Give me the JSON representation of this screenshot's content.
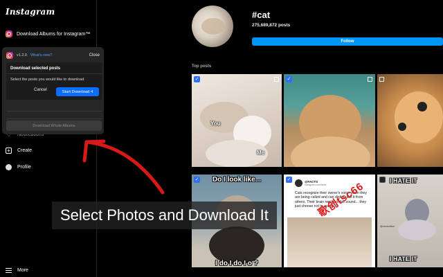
{
  "sidebar": {
    "logo": "Instagram",
    "extension_label": "Download Albums for Instagram™",
    "items": [
      {
        "label": "Notifications"
      },
      {
        "label": "Create"
      },
      {
        "label": "Profile"
      },
      {
        "label": "More"
      }
    ]
  },
  "popup": {
    "version": "v1.2.0",
    "whats_new": "What's new?",
    "close": "Close",
    "card_title": "Download selected posts",
    "card_text": "Select the posts you would like to download",
    "cancel": "Cancel",
    "start": "Start Download 4",
    "whole_albums": "Download Whole Albums"
  },
  "profile": {
    "hashtag": "#cat",
    "posts": "275,689,872 posts",
    "follow": "Follow",
    "top_posts": "Top posts"
  },
  "grid": {
    "t1": {
      "caption_a": "You",
      "caption_b": "Me"
    },
    "t4": {
      "top": "Do I look like...",
      "bottom": "I do I do I o ?"
    },
    "t5": {
      "account": "@FACTS",
      "handle": "instagram.com/facts",
      "text": "Cats recognize their owner's voice when they are being called and can distinguish it from others. Their brain registers the sound... they just choose not to act on it"
    },
    "t6": {
      "top": "I HATE IT",
      "bottom": "I HATE IT",
      "handle": "@vedcattos"
    }
  },
  "watermark": "歌创tsc66",
  "banner": "Select Photos and Download It"
}
